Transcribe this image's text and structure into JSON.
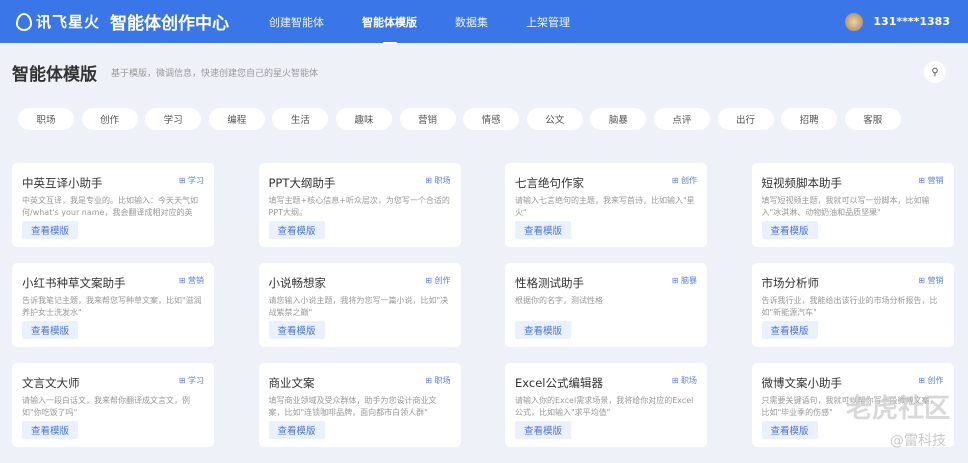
{
  "header": {
    "logo": "讯飞星火",
    "title": "智能体创作中心",
    "nav": [
      {
        "label": "创建智能体",
        "active": false
      },
      {
        "label": "智能体模版",
        "active": true
      },
      {
        "label": "数据集",
        "active": false
      },
      {
        "label": "上架管理",
        "active": false
      }
    ],
    "user": "131****1383"
  },
  "page": {
    "title": "智能体模版",
    "subtitle": "基于模版，微调信息，快速创建您自己的星火智能体",
    "search_icon": "search-icon"
  },
  "tags": [
    "职场",
    "创作",
    "学习",
    "编程",
    "生活",
    "趣味",
    "营销",
    "情感",
    "公文",
    "脑暴",
    "点评",
    "出行",
    "招聘",
    "客服"
  ],
  "button_label": "查看模版",
  "cards": [
    {
      "title": "中英互译小助手",
      "category": "学习",
      "desc": "中英文互译，我是专业的。比如输入：今天天气如何/what's your name，我会翻译成相对应的英文..."
    },
    {
      "title": "PPT大纲助手",
      "category": "职场",
      "desc": "填写主题+核心信息+听众层次，为您写一个合适的PPT大纲。"
    },
    {
      "title": "七言绝句作家",
      "category": "创作",
      "desc": "请输入七言绝句的主题，我来写首诗，比如输入\"星火\""
    },
    {
      "title": "短视频脚本助手",
      "category": "营销",
      "desc": "填写短视频主题，我就可以写一份脚本，比如输入\"冰淇淋、动物奶油和品质坚果\""
    },
    {
      "title": "小红书种草文案助手",
      "category": "营销",
      "desc": "告诉我笔记主题，我来帮您写种草文案，比如\"滋润养护女士洗发水\""
    },
    {
      "title": "小说畅想家",
      "category": "创作",
      "desc": "请您输入小说主题，我将为您写一篇小说，比如\"决战紫禁之巅\""
    },
    {
      "title": "性格测试助手",
      "category": "脑暴",
      "desc": "根据你的名字，测试性格"
    },
    {
      "title": "市场分析师",
      "category": "营销",
      "desc": "告诉我行业，我能给出该行业的市场分析报告，比如\"新能源汽车\""
    },
    {
      "title": "文言文大师",
      "category": "学习",
      "desc": "请输入一段白话文，我来帮你翻译成文言文，例如\"你吃饭了吗\""
    },
    {
      "title": "商业文案",
      "category": "职场",
      "desc": "填写商业领域及受众群体，助手为您设计商业文案，比如\"连锁咖啡品牌，面向都市白领人群\""
    },
    {
      "title": "Excel公式编辑器",
      "category": "职场",
      "desc": "请输入你的Excel需求场景，我将给你对应的Excel公式，比如输入\"求平均值\""
    },
    {
      "title": "微博文案小助手",
      "category": "创作",
      "desc": "只需要关键语句，我就可以帮你写一段微博文案，比如\"毕业季的伤感\""
    }
  ],
  "watermark": {
    "main": "老虎社区",
    "sub": "@雷科技"
  }
}
